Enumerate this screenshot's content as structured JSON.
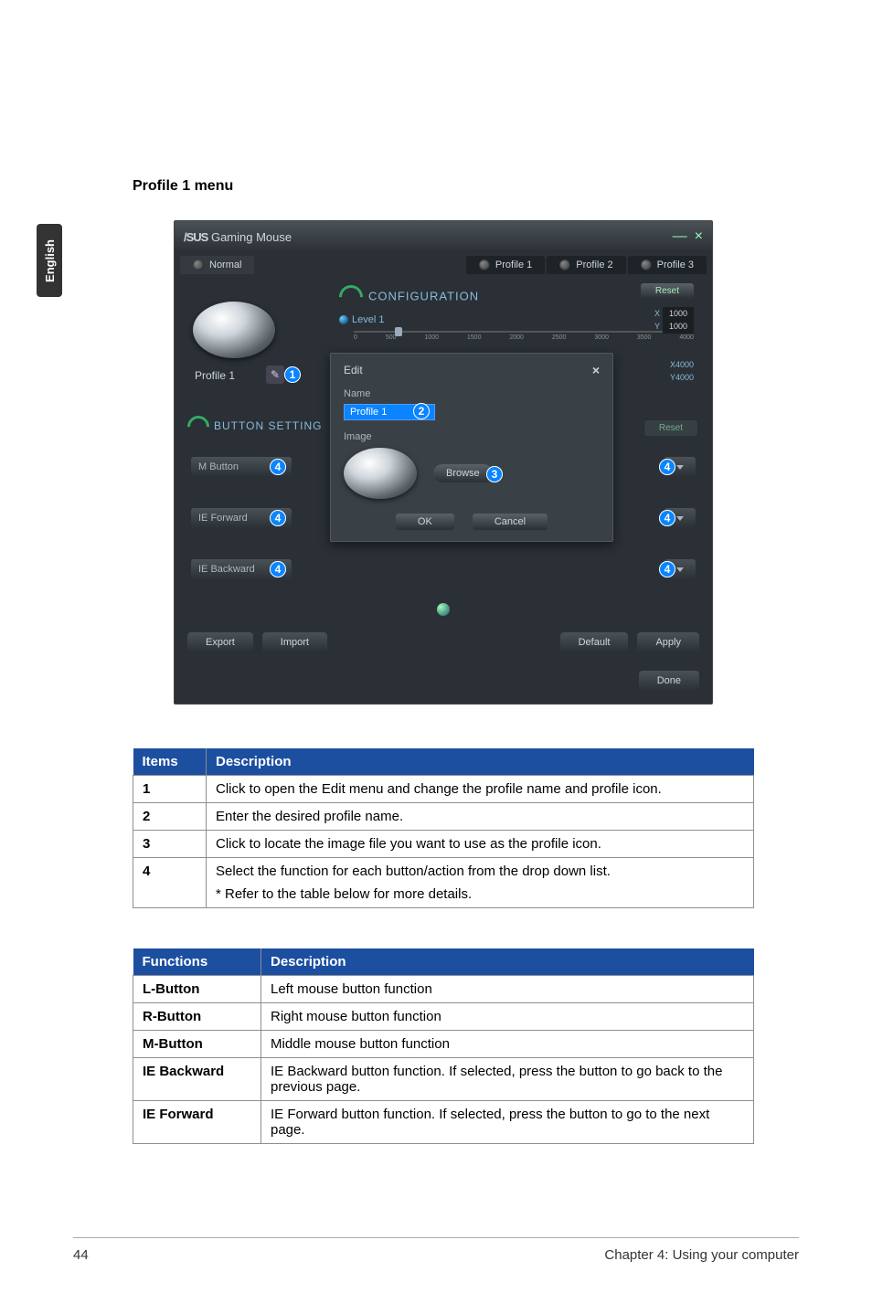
{
  "side_tab": "English",
  "heading": "Profile 1 menu",
  "titlebar": {
    "brand": "/SUS",
    "title": "Gaming Mouse"
  },
  "tabs": {
    "normal": "Normal",
    "p1": "Profile 1",
    "p2": "Profile 2",
    "p3": "Profile 3"
  },
  "config": {
    "label": "CONFIGURATION",
    "level": "Level 1",
    "ticks": [
      "0",
      "500",
      "1000",
      "1500",
      "2000",
      "2500",
      "3000",
      "3500",
      "4000"
    ],
    "reset": "Reset",
    "x1": "1000",
    "y1": "1000",
    "x2": "4000",
    "y2": "4000",
    "xlab": "X",
    "ylab": "Y"
  },
  "profile_under": "Profile 1",
  "popup": {
    "title": "Edit",
    "name_label": "Name",
    "name_value": "Profile 1",
    "image_label": "Image",
    "browse": "Browse",
    "ok": "OK",
    "cancel": "Cancel"
  },
  "button_settings": "BUTTON SETTING",
  "rows": {
    "mbutton": "M Button",
    "ieforward": "IE Forward",
    "iebackward": "IE Backward"
  },
  "sec_reset": "Reset",
  "bottom": {
    "export": "Export",
    "import": "Import",
    "default": "Default",
    "apply": "Apply",
    "done": "Done"
  },
  "table1": {
    "h1": "Items",
    "h2": "Description",
    "r1": {
      "c1": "1",
      "c2": "Click to open the Edit menu and change the profile name and profile icon."
    },
    "r2": {
      "c1": "2",
      "c2": "Enter the desired profile name."
    },
    "r3": {
      "c1": "3",
      "c2": "Click to locate the image file you want to use as the profile icon."
    },
    "r4": {
      "c1": "4",
      "c2a": "Select the function for each button/action from the drop down list.",
      "c2b": "* Refer to the table below for more details."
    }
  },
  "table2": {
    "h1": "Functions",
    "h2": "Description",
    "r1": {
      "c1": "L-Button",
      "c2": "Left mouse button function"
    },
    "r2": {
      "c1": "R-Button",
      "c2": "Right mouse button function"
    },
    "r3": {
      "c1": "M-Button",
      "c2": "Middle mouse button function"
    },
    "r4": {
      "c1": "IE Backward",
      "c2": "IE Backward button function. If selected, press the button to go back to the previous page."
    },
    "r5": {
      "c1": "IE Forward",
      "c2": "IE Forward button function. If selected, press the button to go to the next page."
    }
  },
  "footer": {
    "page": "44",
    "chapter": "Chapter 4: Using your computer"
  }
}
